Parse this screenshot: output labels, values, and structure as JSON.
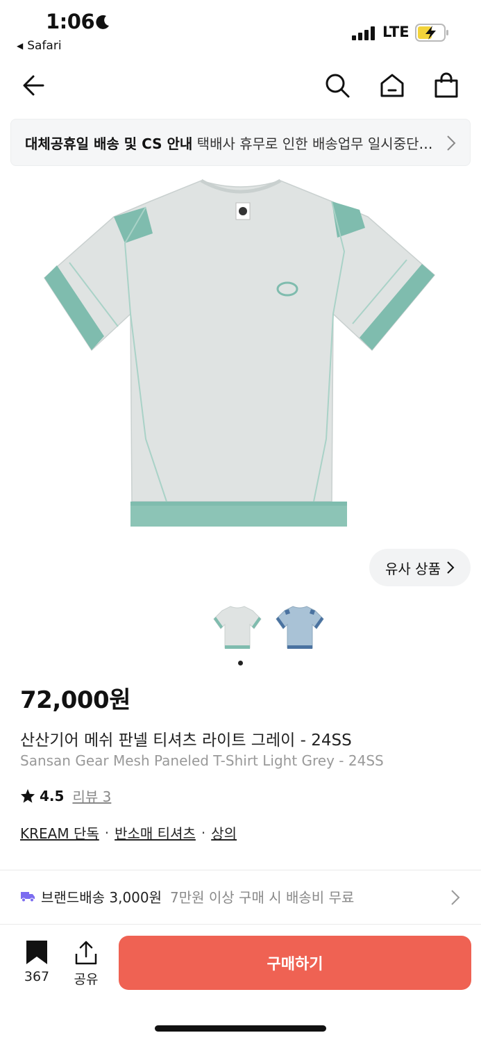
{
  "status_bar": {
    "time": "1:06",
    "back_app": "Safari",
    "network": "LTE"
  },
  "nav": {
    "back_icon": "arrow-left-icon",
    "search_icon": "search-icon",
    "home_icon": "home-icon",
    "cart_icon": "shopping-bag-icon"
  },
  "notice": {
    "title": "대체공휴일 배송 및 CS 안내",
    "body": "택배사 휴무로 인한 배송업무 일시중단 안내"
  },
  "similar": {
    "label": "유사 상품"
  },
  "product": {
    "price": "72,000원",
    "title_ko": "산산기어 메쉬 판넬 티셔츠 라이트 그레이 - 24SS",
    "title_en": "Sansan Gear Mesh Paneled T-Shirt Light Grey - 24SS",
    "rating": "4.5",
    "review_label": "리뷰 3",
    "tags": [
      "KREAM 단독",
      "반소매 티셔츠",
      "상의"
    ],
    "tag_separator": "·",
    "thumbnail_count": 2,
    "current_image": 1
  },
  "delivery": {
    "title": "브랜드배송 3,000원",
    "note": "7만원 이상 구매 시 배송비 무료"
  },
  "bottom_bar": {
    "bookmark_count": "367",
    "share_label": "공유",
    "buy_label": "구매하기"
  },
  "colors": {
    "buy_button": "#ef6253",
    "accent_truck": "#7b6cf0",
    "shirt_body": "#dfe3e2",
    "shirt_trim": "#7fbcae",
    "shirt_alt_body": "#a9c2d6",
    "shirt_alt_trim": "#4a72a0"
  }
}
